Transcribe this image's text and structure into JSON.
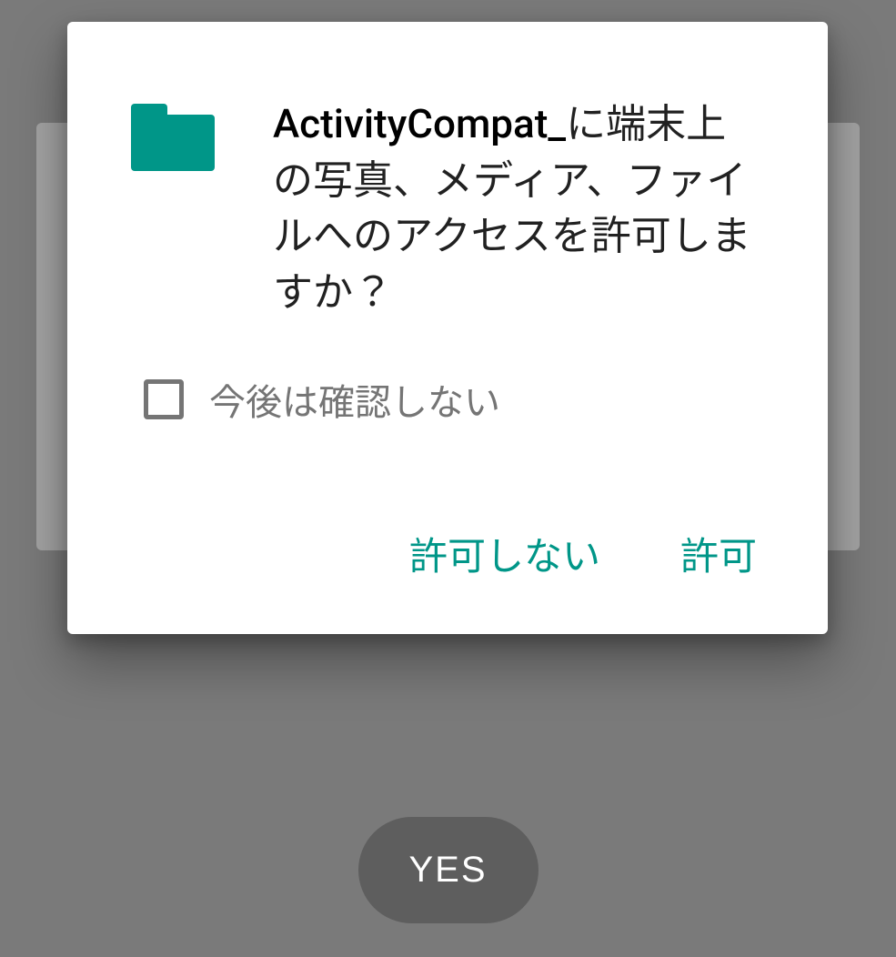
{
  "background": {
    "yes_button_label": "YES"
  },
  "dialog": {
    "app_name": "ActivityCompat_",
    "message_suffix": "に端末上の写真、メディア、ファイルへのアクセスを許可しますか？",
    "checkbox": {
      "label": "今後は確認しない",
      "checked": false
    },
    "actions": {
      "deny_label": "許可しない",
      "allow_label": "許可"
    },
    "icon": "folder-icon",
    "icon_color": "#009688"
  }
}
